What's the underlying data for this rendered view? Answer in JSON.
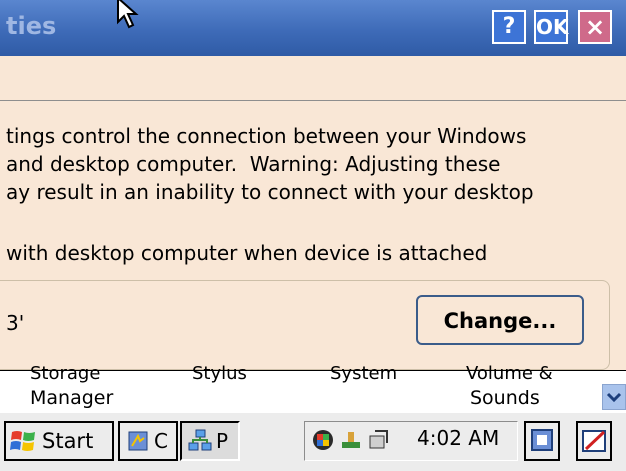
{
  "window": {
    "title_partial": "ties",
    "help_label": "?",
    "ok_label": "OK",
    "close_label": "×"
  },
  "body": {
    "description_lines": [
      "tings control the connection between your Windows",
      "and desktop computer.  Warning: Adjusting these",
      "ay result in an inability to connect with your desktop"
    ],
    "sync_checkbox_label": "with desktop computer when device is attached",
    "device_name_partial": "3'",
    "change_button": "Change..."
  },
  "control_panel": {
    "cut_top_labels": [
      "Storage",
      "Stylus",
      "System",
      "Volume &"
    ],
    "items": [
      "Manager",
      "Sounds"
    ]
  },
  "taskbar": {
    "start_label": "Start",
    "task1_label": "C",
    "task2_label": "P",
    "clock": "4:02 AM"
  },
  "colors": {
    "titlebar": "#3e6bb8",
    "dialog_bg": "#f9e7d6",
    "taskbar": "#ececec"
  },
  "icons": [
    "help-icon",
    "ok-icon",
    "close-icon",
    "mouse-cursor-icon",
    "windows-flag-icon",
    "pocket-pc-icon",
    "network-icon",
    "sync-icon",
    "usb-icon",
    "connection-icon",
    "desktop-icon",
    "input-panel-icon",
    "scroll-down-icon"
  ]
}
